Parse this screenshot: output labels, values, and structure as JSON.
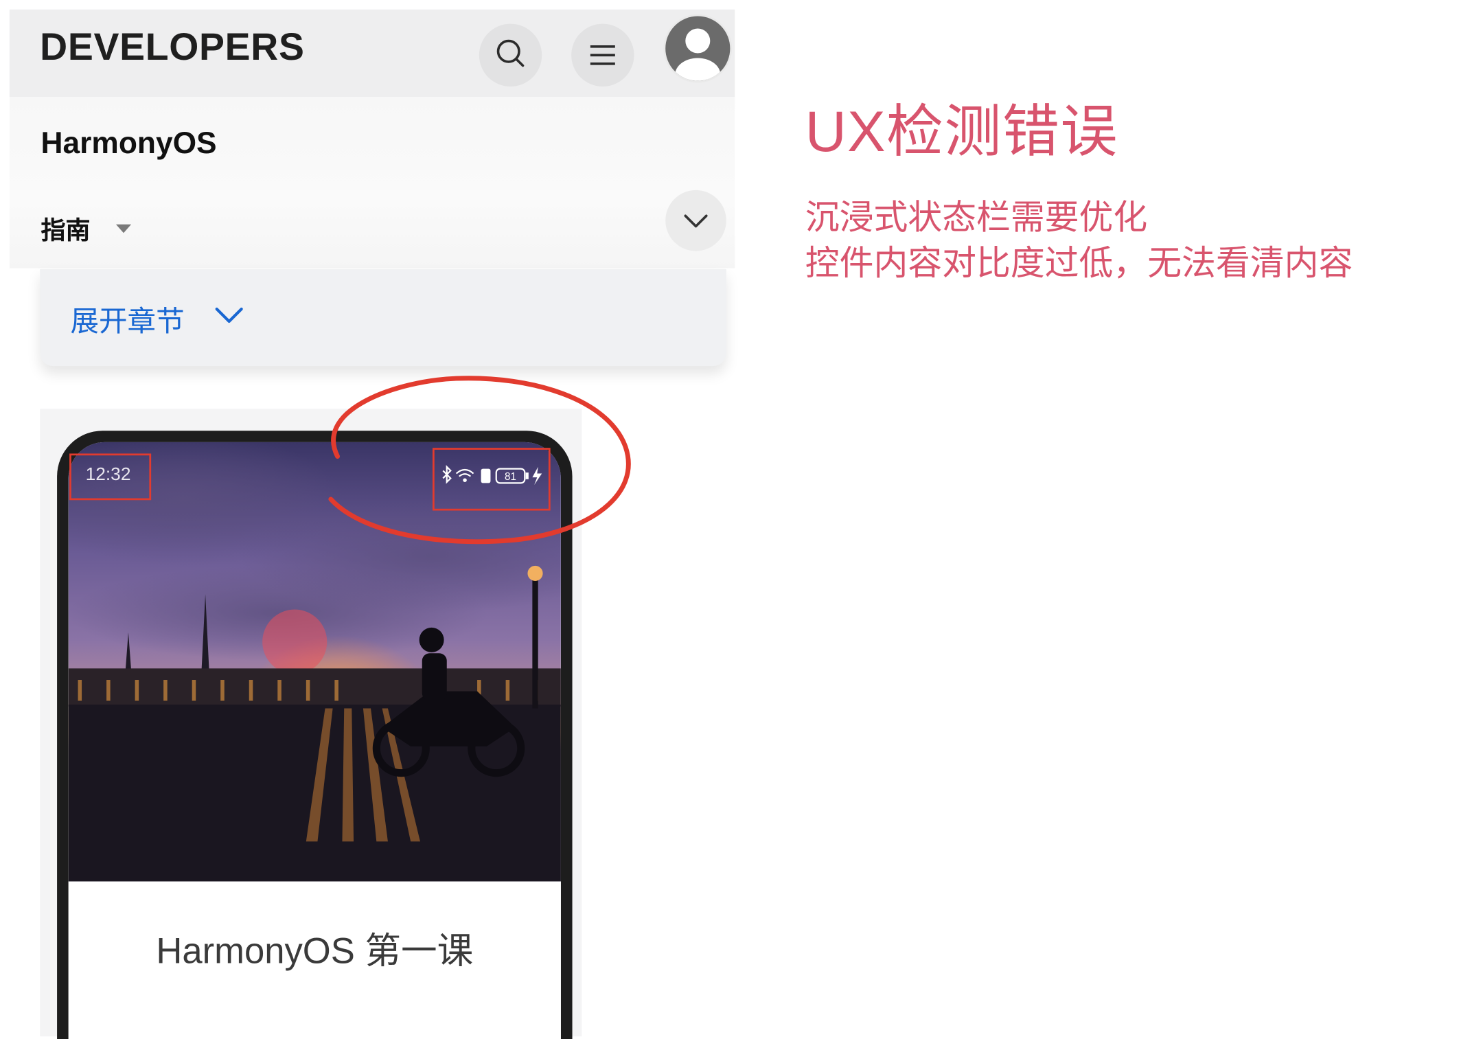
{
  "header": {
    "brand": "DEVELOPERS",
    "search_icon": "search-icon",
    "menu_icon": "menu-icon",
    "avatar_icon": "user-avatar-icon"
  },
  "subheader": {
    "product": "HarmonyOS",
    "guide_label": "指南"
  },
  "chapter": {
    "label": "展开章节"
  },
  "phone": {
    "time": "12:32",
    "battery": "81",
    "caption": "HarmonyOS 第一课"
  },
  "annotation": {
    "title": "UX检测错误",
    "issues": [
      "沉浸式状态栏需要优化",
      "控件内容对比度过低，无法看清内容"
    ]
  },
  "colors": {
    "annotation": "#d8546d",
    "markup_red": "#e23b2e",
    "link_blue": "#1967d2"
  }
}
